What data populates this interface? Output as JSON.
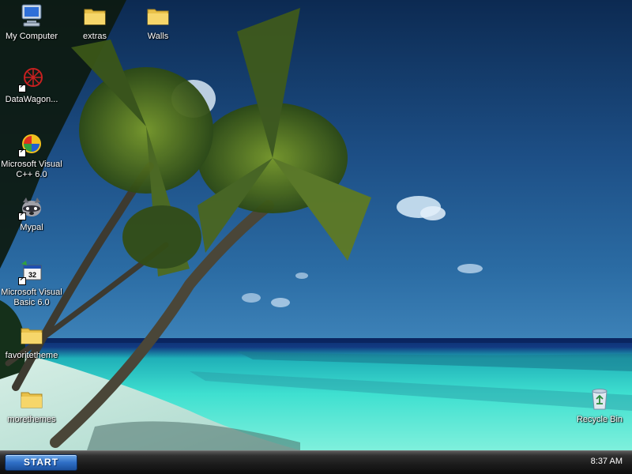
{
  "desktop": {
    "icons": [
      {
        "label": "My Computer",
        "icon": "my-computer-icon"
      },
      {
        "label": "extras",
        "icon": "folder-icon"
      },
      {
        "label": "Walls",
        "icon": "folder-icon"
      },
      {
        "label": "DataWagon...",
        "icon": "datawagon-icon"
      },
      {
        "label": "Microsoft Visual\nC++ 6.0",
        "icon": "visual-cpp-icon"
      },
      {
        "label": "Mypal",
        "icon": "mypal-raccoon-icon"
      },
      {
        "label": "Microsoft Visual\nBasic 6.0",
        "icon": "visual-basic-icon"
      },
      {
        "label": "favoritetheme",
        "icon": "folder-icon"
      },
      {
        "label": "morethemes",
        "icon": "folder-icon"
      },
      {
        "label": "Recycle Bin",
        "icon": "recycle-bin-icon"
      }
    ]
  },
  "taskbar": {
    "start_label": "START",
    "clock": "8:37 AM"
  },
  "colors": {
    "sky_dark": "#0c2a52",
    "sea": "#35d6c8",
    "taskbar": "#1a1a1a",
    "start_button": "#2f6fc6"
  }
}
